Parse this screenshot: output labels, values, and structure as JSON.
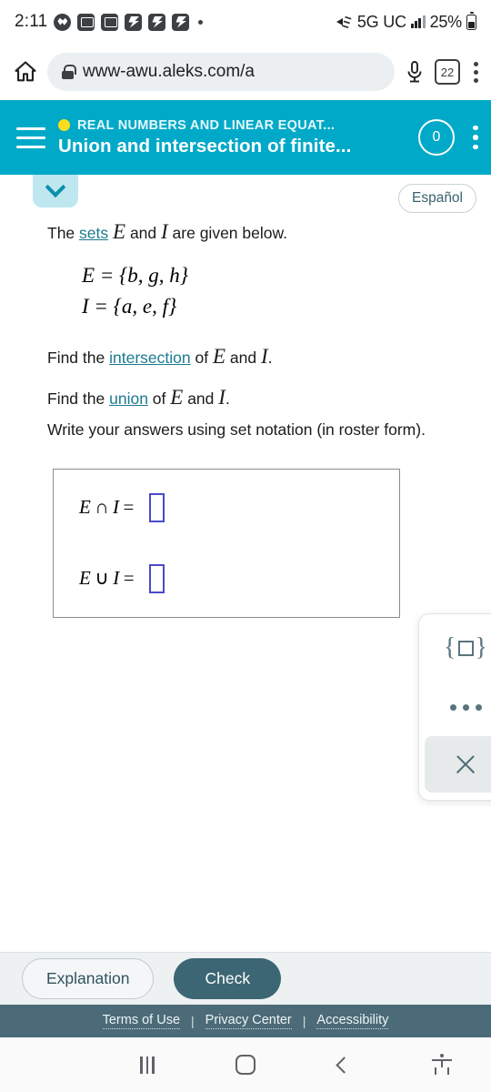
{
  "status_bar": {
    "time": "2:11",
    "notification_icons": [
      "messenger-icon",
      "message-icon",
      "message-icon",
      "messenger-icon",
      "messenger-icon",
      "messenger-icon",
      "more-notifications-dot"
    ],
    "mute_icon": "volume-mute-icon",
    "network": "5G UC",
    "signal_icon": "signal-bars-icon",
    "battery_percent": "25%",
    "battery_icon": "battery-icon"
  },
  "browser": {
    "home_icon": "home-icon",
    "lock_icon": "lock-icon",
    "url": "www-awu.aleks.com/a",
    "mic_icon": "microphone-icon",
    "tab_count": "22",
    "menu_icon": "kebab-menu-icon"
  },
  "app_header": {
    "menu_icon": "hamburger-menu-icon",
    "status_dot_color": "#fbdd1d",
    "topic": "REAL NUMBERS AND LINEAR EQUAT...",
    "subtitle": "Union and intersection of finite...",
    "score": "0",
    "menu_kebab_icon": "kebab-menu-icon",
    "bg_color": "#00a9c7"
  },
  "toolbar": {
    "collapse_icon": "chevron-down-icon",
    "language_button": "Español"
  },
  "problem": {
    "intro_before_link": "The ",
    "intro_link": "sets",
    "intro_mid_1": " ",
    "var_e": "E",
    "intro_mid_2": " and ",
    "var_i": "I",
    "intro_after": " are given below.",
    "set_e": "E = {b, g, h}",
    "set_i": "I = {a, e, f}",
    "task1_before": "Find the ",
    "task1_link": "intersection",
    "task1_after_e": " of ",
    "task1_and": " and ",
    "task1_end": ".",
    "task2_before": "Find the ",
    "task2_link": "union",
    "task3": "Write your answers using set notation (in roster form)."
  },
  "answers": {
    "rows": [
      {
        "left": "E",
        "operator": "∩",
        "right": "I",
        "equals": "=",
        "value": ""
      },
      {
        "left": "E",
        "operator": "∪",
        "right": "I",
        "equals": "=",
        "value": ""
      }
    ],
    "input_border_color": "#4a4ac9"
  },
  "keypad": {
    "set_braces_button": "set-braces-icon",
    "more_button": "ellipsis-icon",
    "close_button": "close-icon"
  },
  "actions": {
    "explanation_label": "Explanation",
    "check_label": "Check",
    "check_color": "#3c6673"
  },
  "footer": {
    "links": [
      "Terms of Use",
      "Privacy Center",
      "Accessibility"
    ],
    "separator": "|",
    "bg_color": "#4b6b78"
  },
  "nav_bar": {
    "recents_icon": "recent-apps-icon",
    "home_icon": "home-square-icon",
    "back_icon": "back-chevron-icon",
    "accessibility_icon": "accessibility-icon"
  }
}
